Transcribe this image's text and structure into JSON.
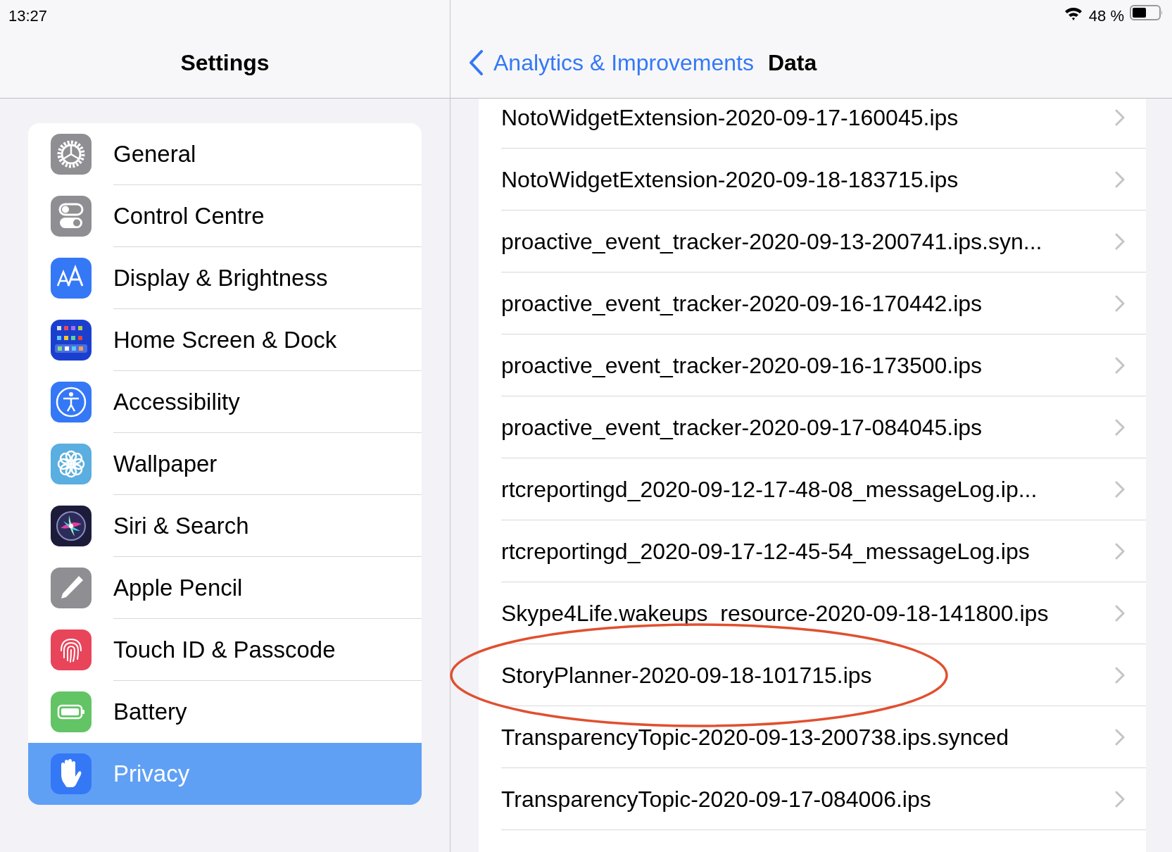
{
  "status_bar": {
    "time": "13:27",
    "battery_text": "48 %"
  },
  "sidebar": {
    "title": "Settings",
    "items": [
      {
        "label": "General",
        "kind": "gear",
        "selected": false
      },
      {
        "label": "Control Centre",
        "kind": "toggles",
        "selected": false
      },
      {
        "label": "Display & Brightness",
        "kind": "text-size",
        "selected": false
      },
      {
        "label": "Home Screen & Dock",
        "kind": "grid",
        "selected": false
      },
      {
        "label": "Accessibility",
        "kind": "figure",
        "selected": false
      },
      {
        "label": "Wallpaper",
        "kind": "flower",
        "selected": false
      },
      {
        "label": "Siri & Search",
        "kind": "orb",
        "selected": false
      },
      {
        "label": "Apple Pencil",
        "kind": "pencil",
        "selected": false
      },
      {
        "label": "Touch ID & Passcode",
        "kind": "fingerprint",
        "selected": false
      },
      {
        "label": "Battery",
        "kind": "battery",
        "selected": false
      },
      {
        "label": "Privacy",
        "kind": "hand",
        "selected": true
      }
    ]
  },
  "detail": {
    "back_label": "Analytics & Improvements",
    "title": "Data",
    "rows": [
      {
        "label": "NotoWidgetExtension-2020-09-17-160045.ips",
        "circled": false
      },
      {
        "label": "NotoWidgetExtension-2020-09-18-183715.ips",
        "circled": false
      },
      {
        "label": "proactive_event_tracker-2020-09-13-200741.ips.syn...",
        "circled": false
      },
      {
        "label": "proactive_event_tracker-2020-09-16-170442.ips",
        "circled": false
      },
      {
        "label": "proactive_event_tracker-2020-09-16-173500.ips",
        "circled": false
      },
      {
        "label": "proactive_event_tracker-2020-09-17-084045.ips",
        "circled": false
      },
      {
        "label": "rtcreportingd_2020-09-12-17-48-08_messageLog.ip...",
        "circled": false
      },
      {
        "label": "rtcreportingd_2020-09-17-12-45-54_messageLog.ips",
        "circled": false
      },
      {
        "label": "Skype4Life.wakeups_resource-2020-09-18-141800.ips",
        "circled": false
      },
      {
        "label": "StoryPlanner-2020-09-18-101715.ips",
        "circled": true
      },
      {
        "label": "TransparencyTopic-2020-09-13-200738.ips.synced",
        "circled": false
      },
      {
        "label": "TransparencyTopic-2020-09-17-084006.ips",
        "circled": false
      }
    ]
  }
}
